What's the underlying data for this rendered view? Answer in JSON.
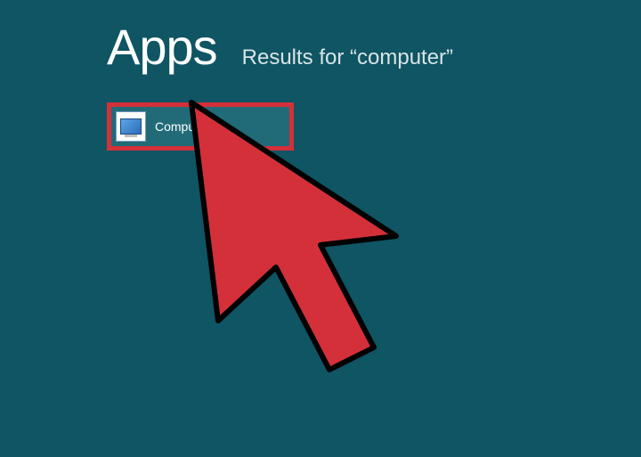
{
  "header": {
    "title": "Apps",
    "results_for_prefix": "Results for ",
    "search_query": "computer",
    "results_for_full": "Results for “computer”"
  },
  "results": [
    {
      "label": "Computer",
      "icon_name": "computer-icon"
    }
  ],
  "annotation": {
    "highlight_color": "#d4303a",
    "cursor_color": "#d4303a"
  }
}
